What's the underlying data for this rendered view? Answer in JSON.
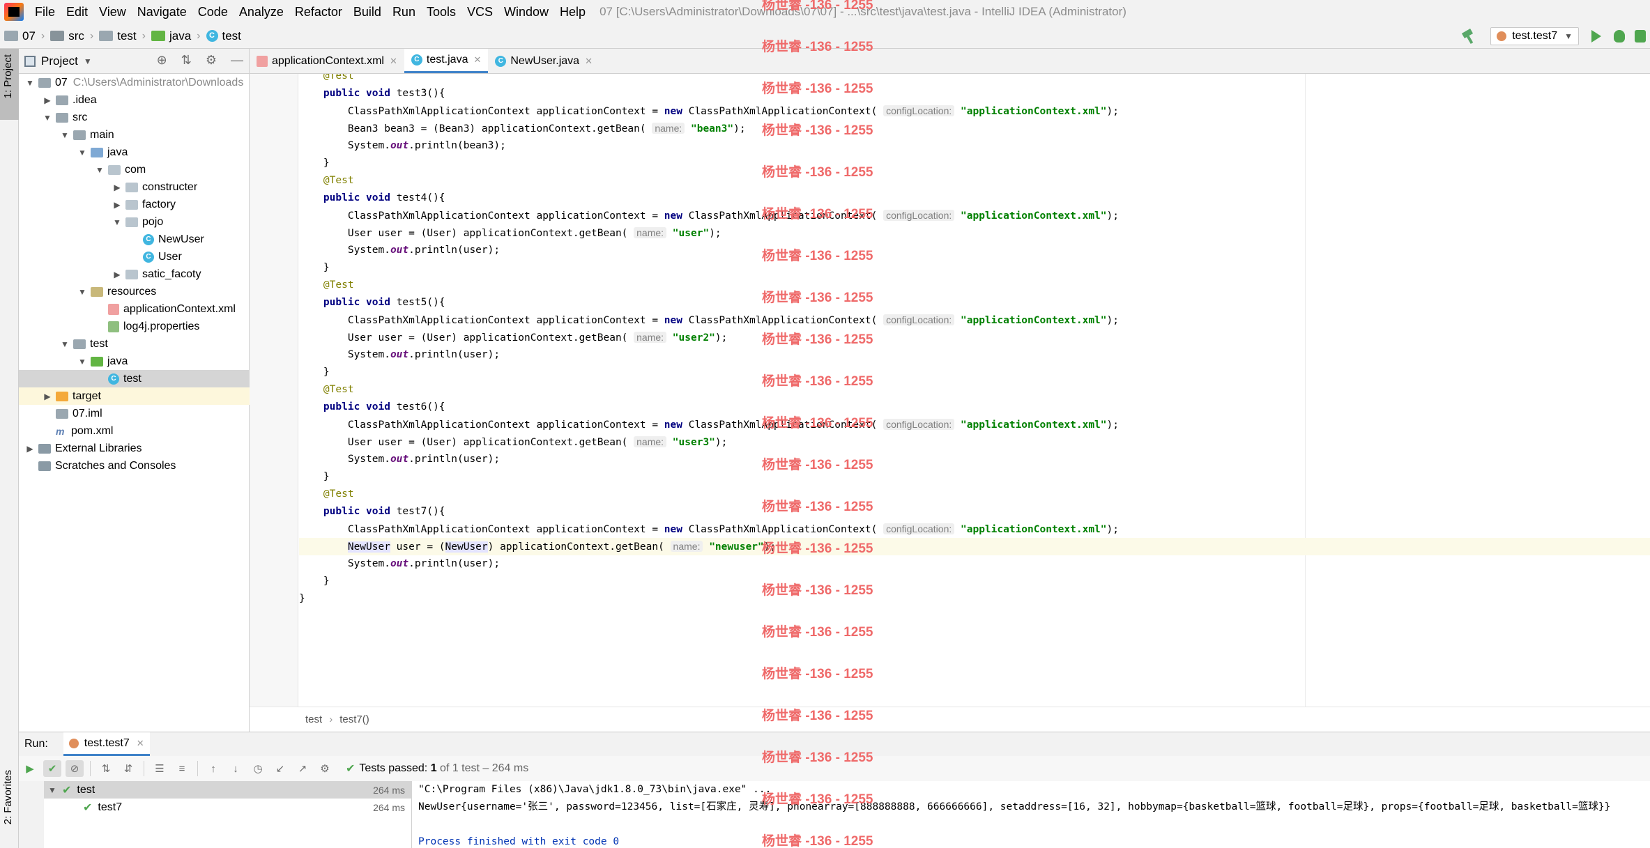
{
  "window": {
    "title": "07 [C:\\Users\\Administrator\\Downloads\\07\\07] - ...\\src\\test\\java\\test.java - IntelliJ IDEA (Administrator)"
  },
  "menu": [
    "File",
    "Edit",
    "View",
    "Navigate",
    "Code",
    "Analyze",
    "Refactor",
    "Build",
    "Run",
    "Tools",
    "VCS",
    "Window",
    "Help"
  ],
  "breadcrumbs": [
    "07",
    "src",
    "test",
    "java",
    "test"
  ],
  "run_config": "test.test7",
  "sidebar": {
    "project_tab": "1: Project",
    "favorites_tab": "2: Favorites"
  },
  "project": {
    "title": "Project",
    "tree": [
      {
        "label": "07",
        "hint": "C:\\Users\\Administrator\\Downloads",
        "level": 0,
        "arrow": "down",
        "icon": "folder"
      },
      {
        "label": ".idea",
        "level": 1,
        "arrow": "right",
        "icon": "folder"
      },
      {
        "label": "src",
        "level": 1,
        "arrow": "down",
        "icon": "folder"
      },
      {
        "label": "main",
        "level": 2,
        "arrow": "down",
        "icon": "folder"
      },
      {
        "label": "java",
        "level": 3,
        "arrow": "down",
        "icon": "blue"
      },
      {
        "label": "com",
        "level": 4,
        "arrow": "down",
        "icon": "pkg"
      },
      {
        "label": "constructer",
        "level": 5,
        "arrow": "right",
        "icon": "pkg"
      },
      {
        "label": "factory",
        "level": 5,
        "arrow": "right",
        "icon": "pkg"
      },
      {
        "label": "pojo",
        "level": 5,
        "arrow": "down",
        "icon": "pkg"
      },
      {
        "label": "NewUser",
        "level": 6,
        "arrow": "",
        "icon": "class"
      },
      {
        "label": "User",
        "level": 6,
        "arrow": "",
        "icon": "class"
      },
      {
        "label": "satic_facoty",
        "level": 5,
        "arrow": "right",
        "icon": "pkg"
      },
      {
        "label": "resources",
        "level": 3,
        "arrow": "down",
        "icon": "res"
      },
      {
        "label": "applicationContext.xml",
        "level": 4,
        "arrow": "",
        "icon": "xml"
      },
      {
        "label": "log4j.properties",
        "level": 4,
        "arrow": "",
        "icon": "prop"
      },
      {
        "label": "test",
        "level": 2,
        "arrow": "down",
        "icon": "folder"
      },
      {
        "label": "java",
        "level": 3,
        "arrow": "down",
        "icon": "green"
      },
      {
        "label": "test",
        "level": 4,
        "arrow": "",
        "icon": "class",
        "selected": true
      },
      {
        "label": "target",
        "level": 1,
        "arrow": "right",
        "icon": "orange",
        "highlight": true
      },
      {
        "label": "07.iml",
        "level": 1,
        "arrow": "",
        "icon": "iml"
      },
      {
        "label": "pom.xml",
        "level": 1,
        "arrow": "",
        "icon": "maven"
      },
      {
        "label": "External Libraries",
        "level": 0,
        "arrow": "right",
        "icon": "lib"
      },
      {
        "label": "Scratches and Consoles",
        "level": 0,
        "arrow": "",
        "icon": "scratch"
      }
    ]
  },
  "editor": {
    "tabs": [
      {
        "label": "applicationContext.xml",
        "icon": "xml",
        "active": false
      },
      {
        "label": "test.java",
        "icon": "class",
        "active": true
      },
      {
        "label": "NewUser.java",
        "icon": "class",
        "active": false
      }
    ],
    "breadcrumb": [
      "test",
      "test7()"
    ],
    "first_line": 22,
    "caret_line": 49,
    "run_gutter_lines": [
      23,
      29,
      35,
      41,
      47
    ],
    "lines": [
      [
        [
          "ann",
          "    @Test"
        ]
      ],
      [
        [
          "kw",
          "    public void "
        ],
        [
          "n",
          "test3(){"
        ]
      ],
      [
        [
          "n",
          "        ClassPathXmlApplicationContext applicationContext = "
        ],
        [
          "kw",
          "new "
        ],
        [
          "n",
          "ClassPathXmlApplicationContext( "
        ],
        [
          "hint",
          "configLocation:"
        ],
        [
          "n",
          " "
        ],
        [
          "str",
          "\"applicationContext.xml\""
        ],
        [
          "n",
          ");"
        ]
      ],
      [
        [
          "n",
          "        Bean3 bean3 = (Bean3) applicationContext.getBean( "
        ],
        [
          "hint",
          "name:"
        ],
        [
          "n",
          " "
        ],
        [
          "str",
          "\"bean3\""
        ],
        [
          "n",
          ");"
        ]
      ],
      [
        [
          "n",
          "        System."
        ],
        [
          "stat",
          "out"
        ],
        [
          "n",
          ".println(bean3);"
        ]
      ],
      [
        [
          "n",
          "    }"
        ]
      ],
      [
        [
          "ann",
          "    @Test"
        ]
      ],
      [
        [
          "kw",
          "    public void "
        ],
        [
          "n",
          "test4(){"
        ]
      ],
      [
        [
          "n",
          "        ClassPathXmlApplicationContext applicationContext = "
        ],
        [
          "kw",
          "new "
        ],
        [
          "n",
          "ClassPathXmlApplicationContext( "
        ],
        [
          "hint",
          "configLocation:"
        ],
        [
          "n",
          " "
        ],
        [
          "str",
          "\"applicationContext.xml\""
        ],
        [
          "n",
          ");"
        ]
      ],
      [
        [
          "n",
          "        User user = (User) applicationContext.getBean( "
        ],
        [
          "hint",
          "name:"
        ],
        [
          "n",
          " "
        ],
        [
          "str",
          "\"user\""
        ],
        [
          "n",
          ");"
        ]
      ],
      [
        [
          "n",
          "        System."
        ],
        [
          "stat",
          "out"
        ],
        [
          "n",
          ".println(user);"
        ]
      ],
      [
        [
          "n",
          "    }"
        ]
      ],
      [
        [
          "ann",
          "    @Test"
        ]
      ],
      [
        [
          "kw",
          "    public void "
        ],
        [
          "n",
          "test5(){"
        ]
      ],
      [
        [
          "n",
          "        ClassPathXmlApplicationContext applicationContext = "
        ],
        [
          "kw",
          "new "
        ],
        [
          "n",
          "ClassPathXmlApplicationContext( "
        ],
        [
          "hint",
          "configLocation:"
        ],
        [
          "n",
          " "
        ],
        [
          "str",
          "\"applicationContext.xml\""
        ],
        [
          "n",
          ");"
        ]
      ],
      [
        [
          "n",
          "        User user = (User) applicationContext.getBean( "
        ],
        [
          "hint",
          "name:"
        ],
        [
          "n",
          " "
        ],
        [
          "str",
          "\"user2\""
        ],
        [
          "n",
          ");"
        ]
      ],
      [
        [
          "n",
          "        System."
        ],
        [
          "stat",
          "out"
        ],
        [
          "n",
          ".println(user);"
        ]
      ],
      [
        [
          "n",
          "    }"
        ]
      ],
      [
        [
          "ann",
          "    @Test"
        ]
      ],
      [
        [
          "kw",
          "    public void "
        ],
        [
          "n",
          "test6(){"
        ]
      ],
      [
        [
          "n",
          "        ClassPathXmlApplicationContext applicationContext = "
        ],
        [
          "kw",
          "new "
        ],
        [
          "n",
          "ClassPathXmlApplicationContext( "
        ],
        [
          "hint",
          "configLocation:"
        ],
        [
          "n",
          " "
        ],
        [
          "str",
          "\"applicationContext.xml\""
        ],
        [
          "n",
          ");"
        ]
      ],
      [
        [
          "n",
          "        User user = (User) applicationContext.getBean( "
        ],
        [
          "hint",
          "name:"
        ],
        [
          "n",
          " "
        ],
        [
          "str",
          "\"user3\""
        ],
        [
          "n",
          ");"
        ]
      ],
      [
        [
          "n",
          "        System."
        ],
        [
          "stat",
          "out"
        ],
        [
          "n",
          ".println(user);"
        ]
      ],
      [
        [
          "n",
          "    }"
        ]
      ],
      [
        [
          "ann",
          "    @Test"
        ]
      ],
      [
        [
          "kw",
          "    public void "
        ],
        [
          "n",
          "test7(){"
        ]
      ],
      [
        [
          "n",
          "        ClassPathXmlApplicationContext applicationContext = "
        ],
        [
          "kw",
          "new "
        ],
        [
          "n",
          "ClassPathXmlApplicationContext( "
        ],
        [
          "hint",
          "configLocation:"
        ],
        [
          "n",
          " "
        ],
        [
          "str",
          "\"applicationContext.xml\""
        ],
        [
          "n",
          ");"
        ]
      ],
      [
        [
          "n",
          "        "
        ],
        [
          "hl",
          "NewUser"
        ],
        [
          "n",
          " user = ("
        ],
        [
          "hl",
          "NewUser"
        ],
        [
          "n",
          ") applicationContext.getBean( "
        ],
        [
          "hint",
          "name:"
        ],
        [
          "n",
          " "
        ],
        [
          "str",
          "\"newuser\""
        ],
        [
          "n",
          ");"
        ]
      ],
      [
        [
          "n",
          "        System."
        ],
        [
          "stat",
          "out"
        ],
        [
          "n",
          ".println(user);"
        ]
      ],
      [
        [
          "n",
          "    }"
        ]
      ],
      [
        [
          "n",
          "}"
        ]
      ],
      [
        [
          "n",
          ""
        ]
      ]
    ]
  },
  "run": {
    "label": "Run:",
    "tab": "test.test7",
    "status_prefix": "Tests passed:",
    "status_count": "1",
    "status_suffix": "of 1 test – 264 ms",
    "tree": [
      {
        "label": "test",
        "time": "264 ms"
      },
      {
        "label": "test7",
        "time": "264 ms"
      }
    ],
    "console": [
      "\"C:\\Program Files (x86)\\Java\\jdk1.8.0_73\\bin\\java.exe\" ...",
      "NewUser{username='张三', password=123456, list=[石家庄, 灵寿], phonearray=[888888888, 666666666], setaddress=[16, 32], hobbymap={basketball=篮球, football=足球}, props={football=足球, basketball=篮球}}",
      "",
      "Process finished with exit code 0"
    ]
  },
  "watermark": "杨世睿 -136 - 1255",
  "colors": {
    "accent": "#4083c9",
    "pass": "#4fa64f",
    "keyword": "#000080",
    "string": "#008000",
    "annotation": "#808000",
    "watermark": "#ef6a6a"
  }
}
